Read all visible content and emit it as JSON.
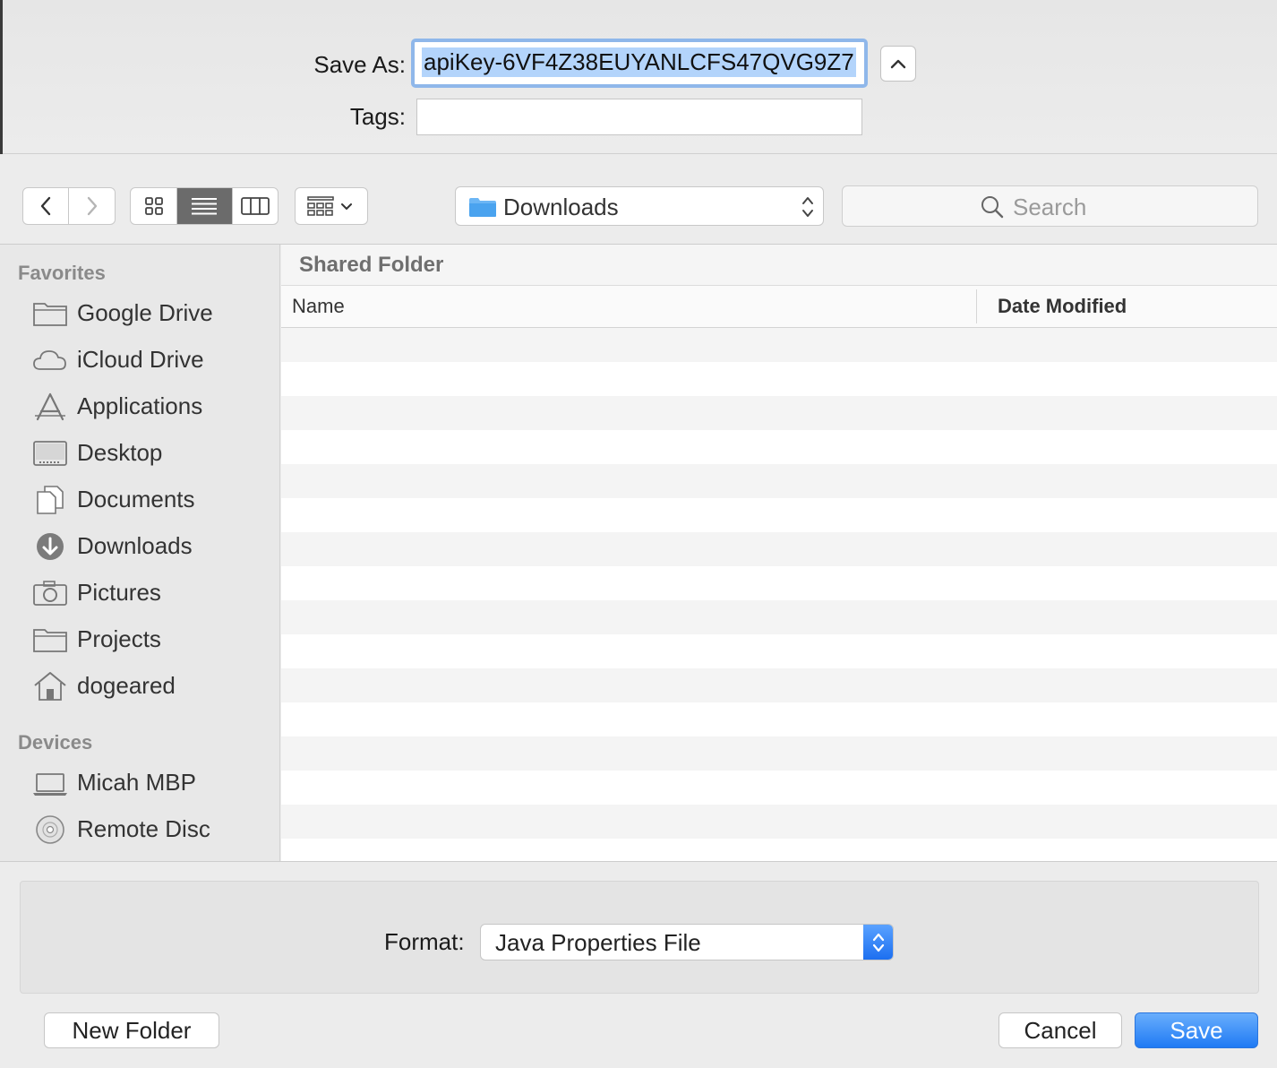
{
  "save_as": {
    "label": "Save As:",
    "value": "apiKey-6VF4Z38EUYANLCFS47QVG9Z7",
    "expand_icon": "chevron-up-icon"
  },
  "tags": {
    "label": "Tags:",
    "value": ""
  },
  "toolbar": {
    "back_icon": "chevron-left-icon",
    "forward_icon": "chevron-right-icon",
    "view_modes": [
      "icon-view",
      "list-view",
      "column-view"
    ],
    "active_view": "list-view",
    "group_icon": "group-by-icon",
    "location": "Downloads",
    "search_placeholder": "Search"
  },
  "sidebar": {
    "favorites_heading": "Favorites",
    "favorites": [
      {
        "label": "Google Drive",
        "icon": "folder-icon"
      },
      {
        "label": "iCloud Drive",
        "icon": "cloud-icon"
      },
      {
        "label": "Applications",
        "icon": "applications-icon"
      },
      {
        "label": "Desktop",
        "icon": "desktop-icon"
      },
      {
        "label": "Documents",
        "icon": "documents-icon"
      },
      {
        "label": "Downloads",
        "icon": "downloads-icon"
      },
      {
        "label": "Pictures",
        "icon": "camera-icon"
      },
      {
        "label": "Projects",
        "icon": "folder-icon"
      },
      {
        "label": "dogeared",
        "icon": "home-icon"
      }
    ],
    "devices_heading": "Devices",
    "devices": [
      {
        "label": "Micah MBP",
        "icon": "laptop-icon"
      },
      {
        "label": "Remote Disc",
        "icon": "disc-icon"
      }
    ]
  },
  "file_area": {
    "folder_title": "Shared Folder",
    "columns": {
      "name": "Name",
      "date_modified": "Date Modified"
    }
  },
  "format": {
    "label": "Format:",
    "value": "Java Properties File"
  },
  "buttons": {
    "new_folder": "New Folder",
    "cancel": "Cancel",
    "save": "Save"
  },
  "colors": {
    "accent": "#1f7af4",
    "selection": "#b3d4fb"
  }
}
